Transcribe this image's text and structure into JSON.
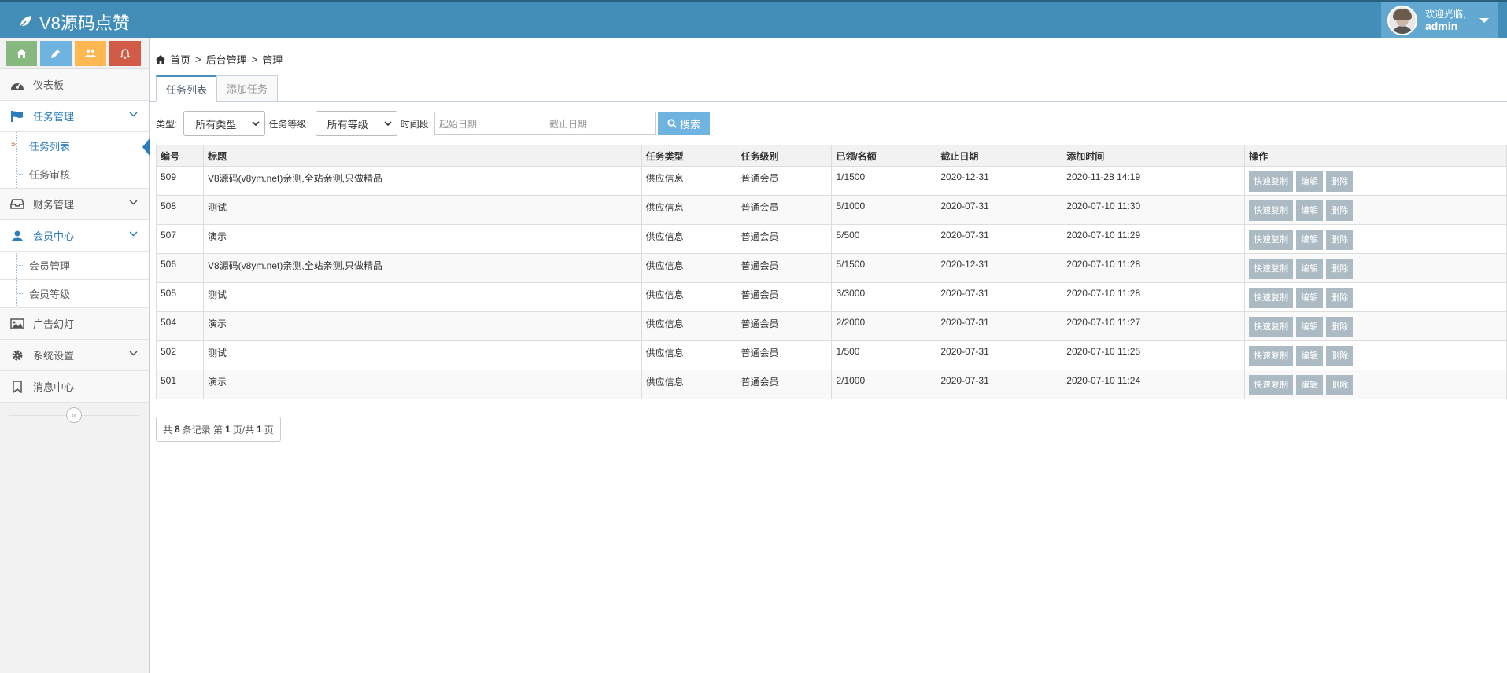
{
  "header": {
    "brand": "V8源码点赞",
    "welcome": "欢迎光临,",
    "username": "admin"
  },
  "shortcuts": [
    "home-icon",
    "pencil-icon",
    "group-icon",
    "bell-icon"
  ],
  "sidebar": {
    "dashboard": "仪表板",
    "task_mgmt": "任务管理",
    "task_list": "任务列表",
    "task_review": "任务审核",
    "finance": "财务管理",
    "member_center": "会员中心",
    "member_mgmt": "会员管理",
    "member_level": "会员等级",
    "ads": "广告幻灯",
    "settings": "系统设置",
    "messages": "消息中心"
  },
  "breadcrumb": {
    "home": "首页",
    "parent": "后台管理",
    "current": "管理"
  },
  "tabs": {
    "list": "任务列表",
    "add": "添加任务"
  },
  "filter": {
    "type_label": "类型:",
    "type_value": "所有类型",
    "level_label": "任务等级:",
    "level_value": "所有等级",
    "period_label": "时间段:",
    "start_placeholder": "起始日期",
    "end_placeholder": "截止日期",
    "search_label": "搜索"
  },
  "table": {
    "headers": [
      "编号",
      "标题",
      "任务类型",
      "任务级别",
      "已领/名额",
      "截止日期",
      "添加时间",
      "操作"
    ],
    "op_labels": {
      "copy": "快速复制",
      "edit": "编辑",
      "delete": "删除"
    },
    "rows": [
      [
        "509",
        "V8源码(v8ym.net)亲测,全站亲测,只做精品",
        "供应信息",
        "普通会员",
        "1/1500",
        "2020-12-31",
        "2020-11-28 14:19"
      ],
      [
        "508",
        "测试",
        "供应信息",
        "普通会员",
        "5/1000",
        "2020-07-31",
        "2020-07-10 11:30"
      ],
      [
        "507",
        "演示",
        "供应信息",
        "普通会员",
        "5/500",
        "2020-07-31",
        "2020-07-10 11:29"
      ],
      [
        "506",
        "V8源码(v8ym.net)亲测,全站亲测,只做精品",
        "供应信息",
        "普通会员",
        "5/1500",
        "2020-12-31",
        "2020-07-10 11:28"
      ],
      [
        "505",
        "测试",
        "供应信息",
        "普通会员",
        "3/3000",
        "2020-07-31",
        "2020-07-10 11:28"
      ],
      [
        "504",
        "演示",
        "供应信息",
        "普通会员",
        "2/2000",
        "2020-07-31",
        "2020-07-10 11:27"
      ],
      [
        "502",
        "测试",
        "供应信息",
        "普通会员",
        "1/500",
        "2020-07-31",
        "2020-07-10 11:25"
      ],
      [
        "501",
        "演示",
        "供应信息",
        "普通会员",
        "2/1000",
        "2020-07-31",
        "2020-07-10 11:24"
      ]
    ]
  },
  "pager": {
    "prefix": "共",
    "total": "8",
    "mid": "条记录 第",
    "page": "1",
    "sep": "页/共",
    "pages": "1",
    "suffix": "页"
  }
}
